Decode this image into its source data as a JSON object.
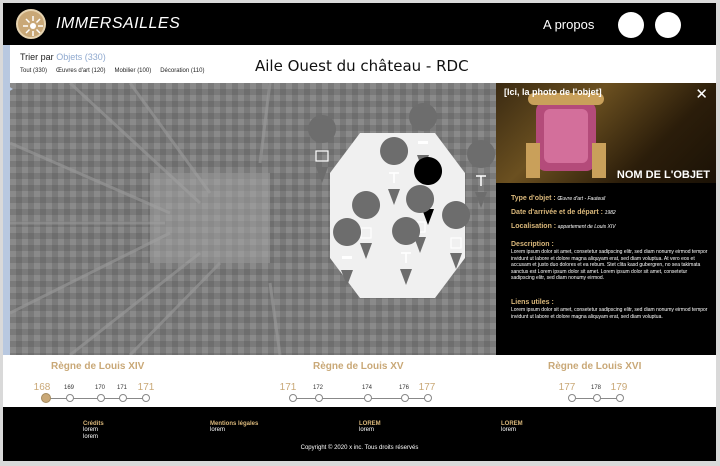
{
  "header": {
    "app_title": "IMMERSAILLES",
    "about_label": "A propos"
  },
  "subheader": {
    "sort_prefix": "Trier par",
    "sort_value": "Objets (330)",
    "filters": [
      "Tout (330)",
      "Œuvres d'art (120)",
      "Mobilier (100)",
      "Décoration (110)"
    ],
    "page_title": "Aile Ouest du château - RDC"
  },
  "panel": {
    "photo_label": "[Ici, la photo de l'objet]",
    "close_icon": "close-icon",
    "object_name": "NOM DE L'OBJET",
    "type_key": "Type d'objet :",
    "type_value": "Œuvre d'art - Fauteuil",
    "date_key": "Date d'arrivée et de départ :",
    "date_value": "1982",
    "location_key": "Localisation :",
    "location_value": "appartement de Louis XIV",
    "description_key": "Description :",
    "description_text": "Lorem ipsum dolor sit amet, consetetur sadipscing elitr, sed diam nonumy eirmod tempor invidunt ut labore et dolore magna aliquyam erat, sed diam voluptua. At vero eos et accusam et justo duo dolores et ea rebum. Stet clita kasd gubergren, no sea takimata sanctus est Lorem ipsum dolor sit amet. Lorem ipsum dolor sit amet, consetetur sadipscing elitr, sed diam nonumy eirmod.",
    "links_key": "Liens utiles :",
    "links_text": "Lorem ipsum dolor sit amet, consetetur sadipscing elitr, sed diam nonumy eirmod tempor invidunt ut labore et dolore magna aliquyam erat, sed diam voluptua."
  },
  "timeline": {
    "reigns": [
      "Règne de Louis XIV",
      "Règne de Louis XV",
      "Règne de Louis XVI"
    ],
    "louis14": [
      "168",
      "169",
      "170",
      "171",
      "171"
    ],
    "louis15": [
      "171",
      "172",
      "174",
      "176",
      "177"
    ],
    "louis16": [
      "177",
      "178",
      "179"
    ]
  },
  "footer": {
    "col1_head": "Crédits",
    "col1_items": [
      "lorem",
      "lorem"
    ],
    "col2_head": "Mentions légales",
    "col2_items": [
      "lorem"
    ],
    "col3_head": "LOREM",
    "col3_items": [
      "lorem"
    ],
    "col4_head": "LOREM",
    "col4_items": [
      "lorem"
    ],
    "copyright": "Copyright  ©  2020 x inc. Tous droits réservés"
  },
  "colors": {
    "accent_gold": "#c9a877",
    "accent_blue": "#8fa9cf",
    "header_bg": "#000000"
  }
}
